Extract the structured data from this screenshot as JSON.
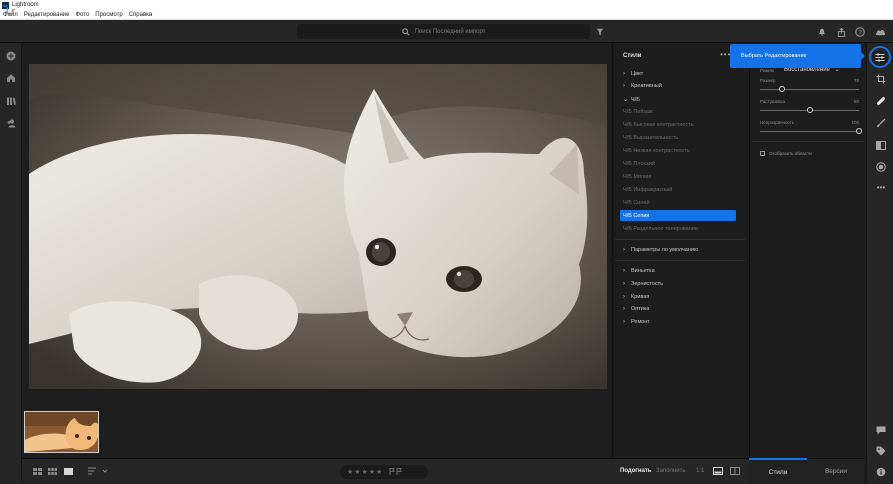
{
  "window": {
    "title": "Lightroom"
  },
  "menu": [
    "Файл",
    "Редактирование",
    "Фото",
    "Просмотр",
    "Справка"
  ],
  "topbar": {
    "logo": "Lr",
    "search_placeholder": "Поиск Последний импорт",
    "icons": [
      "search-icon",
      "filter-icon",
      "bell-icon",
      "share-icon",
      "help-icon",
      "cloud-icon"
    ]
  },
  "styles_panel": {
    "title": "Стили",
    "more": "•••",
    "sections": [
      "Цвет",
      "Креативный"
    ],
    "bw_header": "Ч/Б",
    "bw_items": [
      "Ч/Б Пейзаж",
      "Ч/Б Высокая контрастность",
      "Ч/Б Выразительность",
      "Ч/Б Низкая контрастность",
      "Ч/Б Плоский",
      "Ч/Б Мягкие",
      "Ч/Б Инфракрасный",
      "Ч/Б Синий",
      "Ч/Б Сепия",
      "Ч/Б Раздельное тонирование"
    ],
    "selected_item": "Ч/Б Сепия",
    "defaults": "Параметры по умолчанию",
    "bottom_sections": [
      "Виньетка",
      "Зернистость",
      "Кривая",
      "Оптика",
      "Ремонт"
    ]
  },
  "edit_panel": {
    "mode_label": "Режим",
    "mode_value": "Восстановление",
    "sliders": [
      {
        "label": "Размер",
        "value": "78",
        "level": 0.22
      },
      {
        "label": "Растушевка",
        "value": "50",
        "level": 0.5
      },
      {
        "label": "Непрозрачность",
        "value": "100",
        "level": 1.0
      }
    ],
    "show_overlay": "Отобразить области"
  },
  "tooltip": {
    "text": "Выбрать Редактирование"
  },
  "bottombar": {
    "stars": "★★★★★",
    "fit": "Подогнать",
    "fill": "Заполнить",
    "ratio": "1:1"
  },
  "tabs": {
    "styles": "Стили",
    "versions": "Версии"
  },
  "colors": {
    "accent": "#1473e6",
    "panel": "#1d1d1d",
    "chrome": "#262626"
  }
}
